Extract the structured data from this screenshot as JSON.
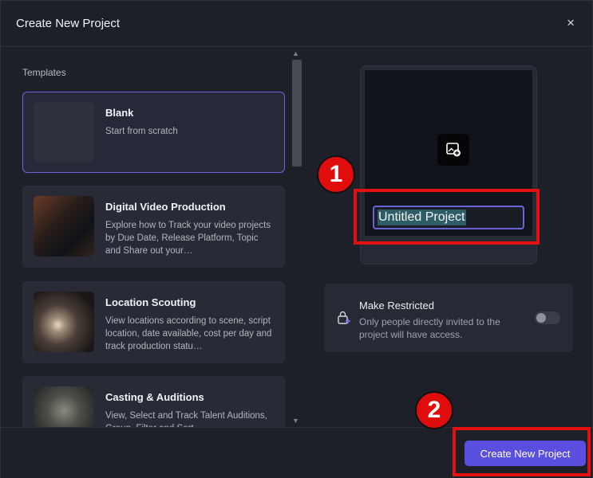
{
  "dialog": {
    "title": "Create New Project",
    "close_icon": "×"
  },
  "templates": {
    "section_label": "Templates",
    "items": [
      {
        "title": "Blank",
        "description": "Start from scratch",
        "selected": true
      },
      {
        "title": "Digital Video Production",
        "description": "Explore how to Track your video projects by Due Date, Release Platform, Topic and Share out your…"
      },
      {
        "title": "Location Scouting",
        "description": "View locations according to scene, script location, date available, cost per day and track production statu…"
      },
      {
        "title": "Casting & Auditions",
        "description": "View, Select and Track Talent Auditions, Group, Filter and Sort…"
      }
    ]
  },
  "project": {
    "name_value": "Untitled Project",
    "add_image_icon": "image-plus-icon"
  },
  "restricted": {
    "title": "Make Restricted",
    "description": "Only people directly invited to the project will have access.",
    "enabled": false
  },
  "footer": {
    "create_label": "Create New Project"
  },
  "annotations": {
    "badge_1": "1",
    "badge_2": "2",
    "color": "#e60f0f"
  }
}
